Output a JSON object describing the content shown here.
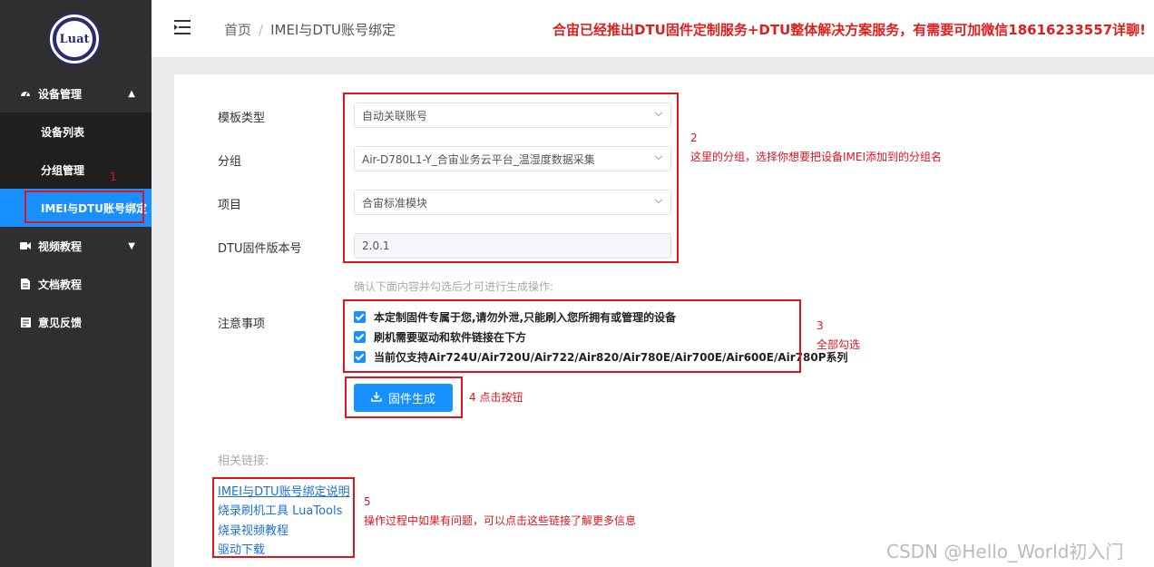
{
  "sidebar": {
    "logo_text": "Luat",
    "items": [
      {
        "label": "设备管理",
        "icon": "dashboard-icon",
        "chevron": "▲"
      },
      {
        "label": "视频教程",
        "icon": "video-icon",
        "chevron": "▼"
      },
      {
        "label": "文档教程",
        "icon": "document-icon"
      },
      {
        "label": "意见反馈",
        "icon": "feedback-icon"
      }
    ],
    "subitems": [
      {
        "label": "设备列表"
      },
      {
        "label": "分组管理"
      },
      {
        "label": "IMEI与DTU账号绑定",
        "active": true
      }
    ]
  },
  "header": {
    "breadcrumb_home": "首页",
    "breadcrumb_sep": "/",
    "breadcrumb_current": "IMEI与DTU账号绑定",
    "announcement": "合宙已经推出DTU固件定制服务+DTU整体解决方案服务，有需要可加微信18616233557详聊!"
  },
  "form": {
    "template_type_label": "模板类型",
    "template_type_value": "自动关联账号",
    "group_label": "分组",
    "group_value": "Air-D780L1-Y_合宙业务云平台_温湿度数据采集",
    "project_label": "项目",
    "project_value": "合宙标准模块",
    "version_label": "DTU固件版本号",
    "version_value": "2.0.1",
    "confirm_hint": "确认下面内容并勾选后才可进行生成操作:",
    "notice_label": "注意事项",
    "checks": [
      "本定制固件专属于您,请勿外泄,只能刷入您所拥有或管理的设备",
      "刷机需要驱动和软件链接在下方",
      "当前仅支持Air724U/Air720U/Air722/Air820/Air780E/Air700E/Air600E/Air780P系列"
    ],
    "generate_button": "固件生成"
  },
  "related": {
    "title": "相关链接:",
    "links": [
      "IMEI与DTU账号绑定说明",
      "烧录刷机工具 LuaTools",
      "烧录视频教程",
      "驱动下载"
    ]
  },
  "annotations": {
    "n1": "1",
    "n2_num": "2",
    "n2_text": "这里的分组，选择你想要把设备IMEI添加到的分组名",
    "n3_num": "3",
    "n3_text": "全部勾选",
    "n4_text": "4 点击按钮",
    "n5_num": "5",
    "n5_text": "操作过程中如果有问题，可以点击这些链接了解更多信息"
  },
  "watermark": "CSDN @Hello_World初入门",
  "colors": {
    "sidebar_bg": "#2f2f2f",
    "submenu_bg": "#1f1f1f",
    "active_blue": "#1890ff",
    "announce_red": "#e01e1e",
    "annotation_red": "#e0141e"
  }
}
